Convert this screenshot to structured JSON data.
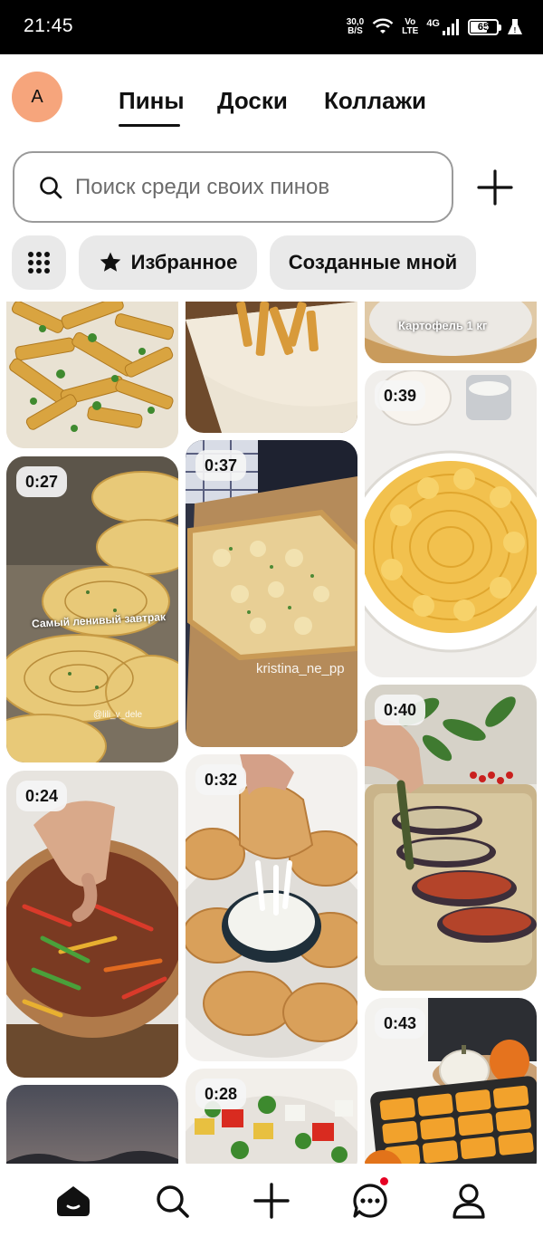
{
  "status_bar": {
    "time": "21:45",
    "net_speed_value": "30,0",
    "net_speed_unit": "B/S",
    "volte_top": "Vo",
    "volte_bottom": "LTE",
    "network": "4G",
    "battery": "65"
  },
  "header": {
    "avatar_initial": "A",
    "tabs": [
      {
        "label": "Пины",
        "active": true
      },
      {
        "label": "Доски",
        "active": false
      },
      {
        "label": "Коллажи",
        "active": false
      }
    ]
  },
  "search": {
    "placeholder": "Поиск среди своих пинов"
  },
  "filters": {
    "favorites_label": "Избранное",
    "created_label": "Созданные мной"
  },
  "pins": {
    "col1": [
      {
        "subject": "fried potato wedges with herbs"
      },
      {
        "duration": "0:27",
        "caption": "Самый ленивый завтрак",
        "watermark": "@lili_v_dele"
      },
      {
        "duration": "0:24",
        "subject": "beef and vegetable salad"
      },
      {
        "subject": "evening sky"
      }
    ],
    "col2": [
      {
        "subject": "fries on lavash"
      },
      {
        "duration": "0:37",
        "watermark": "kristina_ne_pp"
      },
      {
        "duration": "0:32",
        "subject": "fried chicken with sauce"
      },
      {
        "duration": "0:28",
        "subject": "greek salad"
      }
    ],
    "col3": [
      {
        "caption": "Картофель 1 кг"
      },
      {
        "duration": "0:39",
        "subject": "potato gratin"
      },
      {
        "duration": "0:40",
        "subject": "stuffed eggplant"
      },
      {
        "duration": "0:43",
        "subject": "pumpkin casserole"
      }
    ]
  },
  "colors": {
    "accent_notification": "#e60023",
    "avatar_bg": "#f6a57c",
    "chip_bg": "#e9e9e9"
  },
  "bottom_nav": [
    "home-icon",
    "search-icon",
    "plus-icon",
    "chat-icon",
    "profile-icon"
  ]
}
